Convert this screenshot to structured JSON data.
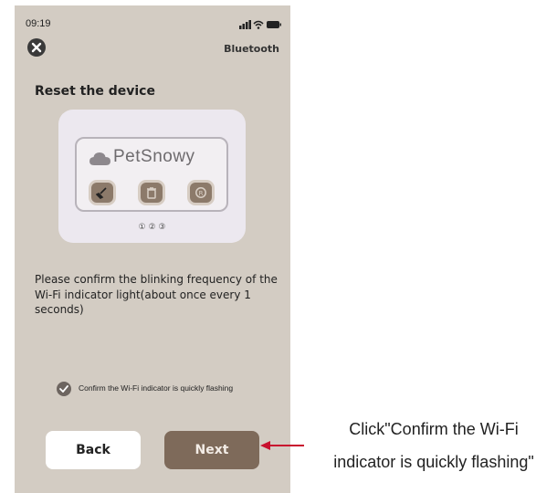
{
  "status_bar": {
    "time": "09:19"
  },
  "header": {
    "close_icon": "close-icon",
    "bluetooth_label": "Bluetooth"
  },
  "title": "Reset the device",
  "device_image": {
    "brand": "PetSnowy",
    "button_numbers": "① ② ③",
    "icons": [
      "broom-icon",
      "trash-icon",
      "reset-icon"
    ]
  },
  "instruction": "Please confirm the blinking frequency of the Wi-Fi indicator light(about once every 1 seconds)",
  "confirm": {
    "label": "Confirm the Wi-Fi indicator is quickly flashing",
    "checked": true
  },
  "buttons": {
    "back": "Back",
    "next": "Next"
  },
  "annotation": {
    "line1": "Click\"Confirm the Wi-Fi",
    "line2": "indicator is quickly flashing\""
  },
  "colors": {
    "background": "#d3ccc3",
    "accent": "#7e6a5a",
    "arrow": "#c8102e"
  }
}
